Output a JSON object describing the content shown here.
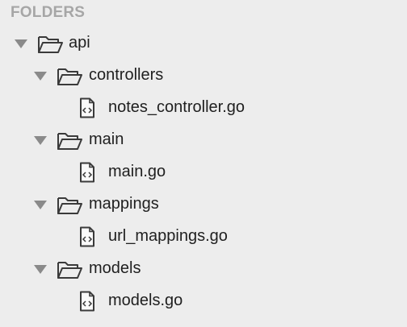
{
  "sidebar": {
    "header": "FOLDERS",
    "root": {
      "label": "api",
      "icon": "open-folder-icon",
      "expanded": true
    },
    "folders": [
      {
        "label": "controllers",
        "icon": "open-folder-icon",
        "expanded": true,
        "file": {
          "label": "notes_controller.go",
          "icon": "code-file-icon"
        }
      },
      {
        "label": "main",
        "icon": "open-folder-icon",
        "expanded": true,
        "file": {
          "label": "main.go",
          "icon": "code-file-icon"
        }
      },
      {
        "label": "mappings",
        "icon": "open-folder-icon",
        "expanded": true,
        "file": {
          "label": "url_mappings.go",
          "icon": "code-file-icon"
        }
      },
      {
        "label": "models",
        "icon": "open-folder-icon",
        "expanded": true,
        "file": {
          "label": "models.go",
          "icon": "code-file-icon"
        }
      }
    ]
  },
  "colors": {
    "background": "#ededed",
    "header_text": "#a6a6a6",
    "label_text": "#1f1f1f",
    "arrow": "#8a8a8a",
    "icon_stroke": "#3a3a3a"
  }
}
